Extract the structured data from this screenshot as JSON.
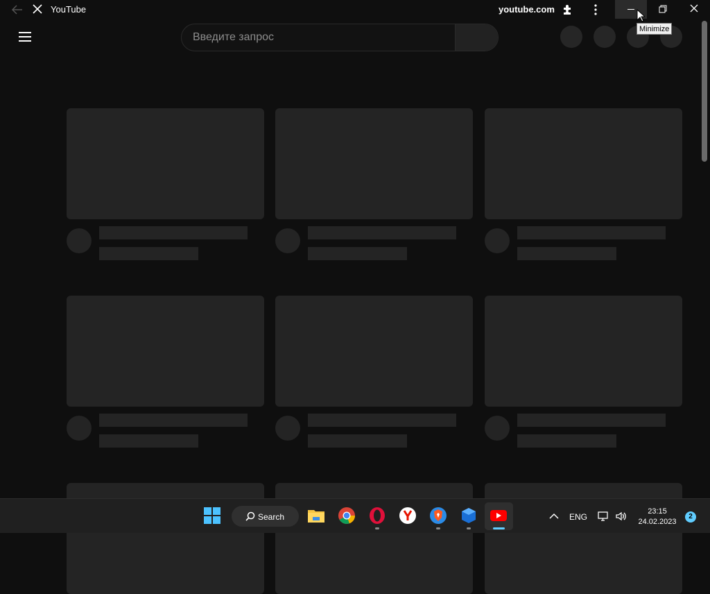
{
  "titlebar": {
    "title": "YouTube",
    "url": "youtube.com",
    "tooltip": "Minimize"
  },
  "header": {
    "search_placeholder": "Введите запрос"
  },
  "taskbar": {
    "search_label": "Search",
    "language": "ENG",
    "time": "23:15",
    "date": "24.02.2023",
    "notification_count": "2",
    "apps": [
      "file-explorer",
      "chrome",
      "opera",
      "yandex-browser",
      "brave",
      "windows-sandbox",
      "youtube"
    ]
  },
  "colors": {
    "background": "#0f0f0f",
    "skeleton": "#242424",
    "accent": "#60cdff",
    "youtube_red": "#ff0000"
  }
}
